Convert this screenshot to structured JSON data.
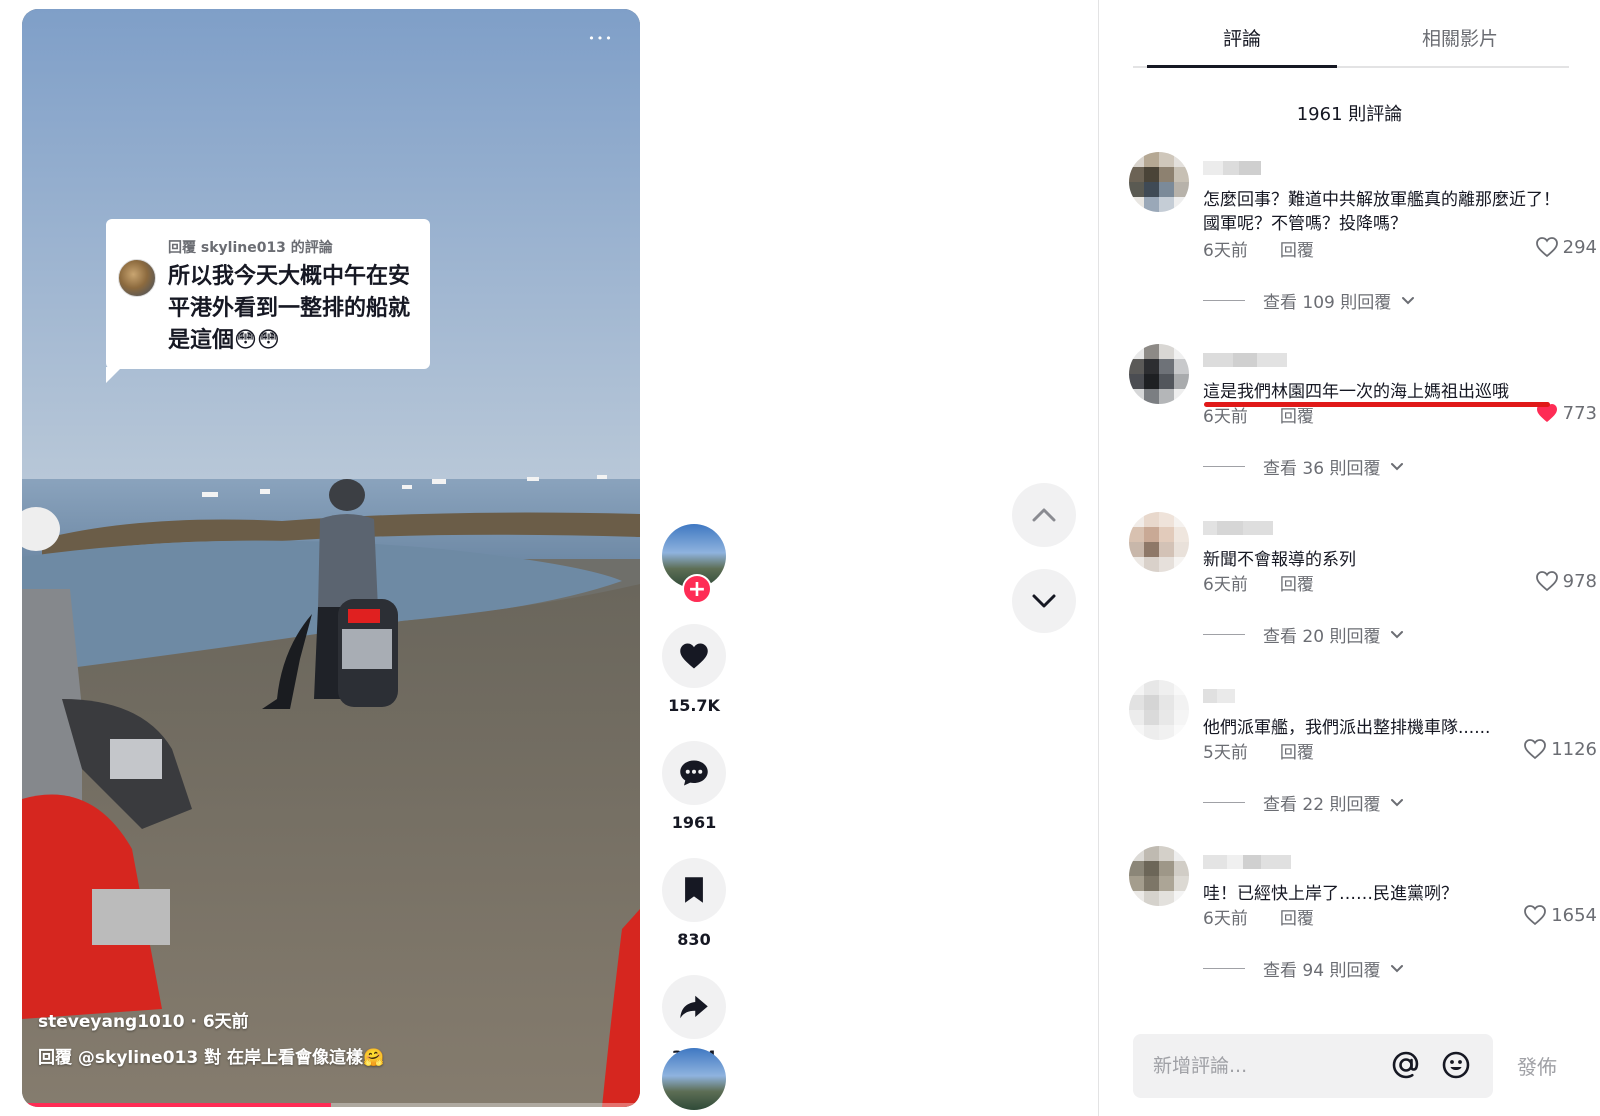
{
  "video": {
    "reply_header": "回覆 skyline013 的評論",
    "reply_text": "所以我今天大概中午在安平港外看到一整排的船就是這個😳😳",
    "author_line": "steveyang1010 · 6天前",
    "caption": "回覆 @skyline013  對 在岸上看會像這樣🤗",
    "progress": 0.5
  },
  "actions": {
    "likes": "15.7K",
    "comments": "1961",
    "saves": "830",
    "shares": "3724"
  },
  "panel": {
    "tabs": [
      {
        "label": "評論",
        "active": true
      },
      {
        "label": "相關影片",
        "active": false
      }
    ],
    "comment_count": "1961 則評論",
    "comments": [
      {
        "text": "怎麼回事？難道中共解放軍艦真的離那麼近了！國軍呢？不管嗎？投降嗎？",
        "time": "6天前",
        "reply": "回覆",
        "likes": "294",
        "liked": false,
        "view_replies": "查看 109 則回覆"
      },
      {
        "text": "這是我們林園四年一次的海上媽祖出巡哦",
        "time": "6天前",
        "reply": "回覆",
        "likes": "773",
        "liked": true,
        "view_replies": "查看 36 則回覆"
      },
      {
        "text": "新聞不會報導的系列",
        "time": "6天前",
        "reply": "回覆",
        "likes": "978",
        "liked": false,
        "view_replies": "查看 20 則回覆"
      },
      {
        "text": "他們派軍艦，我們派出整排機車隊......",
        "time": "5天前",
        "reply": "回覆",
        "likes": "1126",
        "liked": false,
        "view_replies": "查看 22 則回覆"
      },
      {
        "text": "哇！已經快上岸了……民進黨咧？",
        "time": "6天前",
        "reply": "回覆",
        "likes": "1654",
        "liked": false,
        "view_replies": "查看 94 則回覆"
      }
    ],
    "composer": {
      "placeholder": "新增評論...",
      "post_label": "發佈"
    }
  },
  "colors": {
    "accent": "#fe2c55",
    "liked": "#fe2c55",
    "annotation": "#e01919"
  },
  "icons": [
    "more-icon",
    "plus-icon",
    "heart-icon",
    "comment-icon",
    "bookmark-icon",
    "share-icon",
    "chevron-up-icon",
    "chevron-down-icon",
    "at-icon",
    "emoji-icon"
  ]
}
